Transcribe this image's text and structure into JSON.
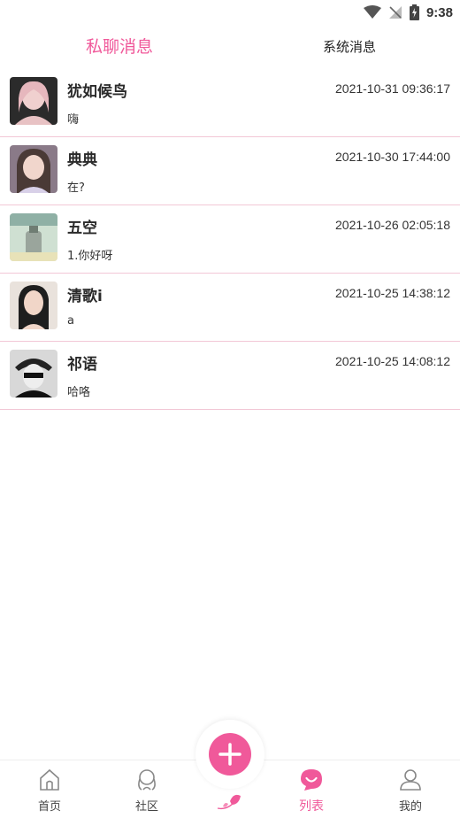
{
  "status_bar": {
    "time": "9:38",
    "icons": [
      "wifi-icon",
      "no-signal-icon",
      "battery-charging-icon"
    ]
  },
  "tabs": {
    "private": "私聊消息",
    "system": "系统消息",
    "active": "private"
  },
  "messages": [
    {
      "name": "犹如候鸟",
      "time": "2021-10-31 09:36:17",
      "text": "嗨",
      "avatar_colors": [
        "#2b2b2b",
        "#e8c2c4"
      ]
    },
    {
      "name": "典典",
      "time": "2021-10-30 17:44:00",
      "text": "在?",
      "avatar_colors": [
        "#6a5a55",
        "#d8b8b0"
      ]
    },
    {
      "name": "五空",
      "time": "2021-10-26 02:05:18",
      "text": "1.你好呀",
      "avatar_colors": [
        "#b9cfc0",
        "#e8e2b8"
      ]
    },
    {
      "name": "清歌i",
      "time": "2021-10-25 14:38:12",
      "text": "a",
      "avatar_colors": [
        "#1e1e1e",
        "#f1d6c8"
      ]
    },
    {
      "name": "祁语",
      "time": "2021-10-25 14:08:12",
      "text": "哈咯",
      "avatar_colors": [
        "#111111",
        "#dddddd"
      ]
    }
  ],
  "bottom_nav": [
    {
      "label": "首页",
      "icon": "home-icon"
    },
    {
      "label": "社区",
      "icon": "community-icon"
    },
    {
      "label": "",
      "icon": "flower-icon"
    },
    {
      "label": "列表",
      "icon": "list-smile-icon",
      "active": true
    },
    {
      "label": "我的",
      "icon": "profile-icon"
    }
  ],
  "fab": {
    "icon": "plus-icon"
  },
  "colors": {
    "accent": "#f0599a",
    "divider": "#f2c7d6"
  }
}
